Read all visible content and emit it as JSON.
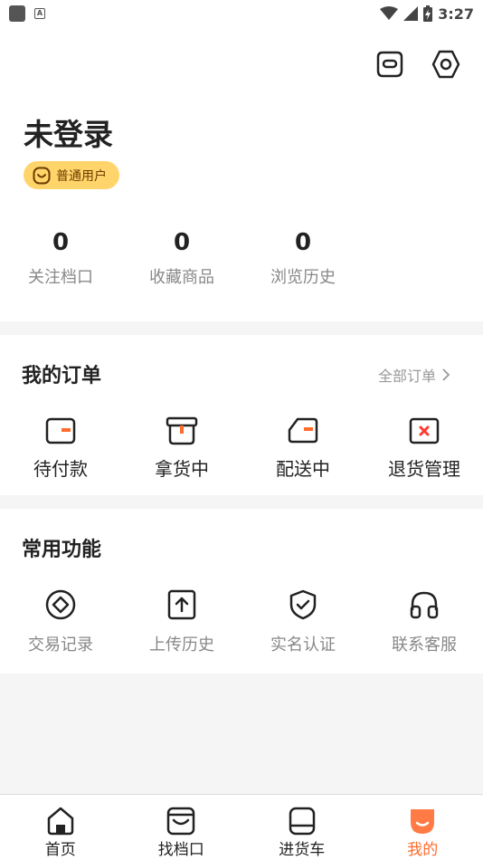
{
  "status_bar": {
    "time": "3:27",
    "battery": "⚡"
  },
  "profile": {
    "name": "未登录",
    "badge": "普通用户"
  },
  "stats": [
    {
      "value": "0",
      "label": "关注档口"
    },
    {
      "value": "0",
      "label": "收藏商品"
    },
    {
      "value": "0",
      "label": "浏览历史"
    }
  ],
  "orders": {
    "title": "我的订单",
    "all_label": "全部订单",
    "items": [
      {
        "label": "待付款",
        "icon": "wallet-icon"
      },
      {
        "label": "拿货中",
        "icon": "box-icon"
      },
      {
        "label": "配送中",
        "icon": "truck-icon"
      },
      {
        "label": "退货管理",
        "icon": "return-icon"
      }
    ]
  },
  "functions": {
    "title": "常用功能",
    "items": [
      {
        "label": "交易记录",
        "icon": "diamond-record-icon"
      },
      {
        "label": "上传历史",
        "icon": "upload-icon"
      },
      {
        "label": "实名认证",
        "icon": "shield-check-icon"
      },
      {
        "label": "联系客服",
        "icon": "headset-icon"
      }
    ]
  },
  "tabbar": [
    {
      "label": "首页",
      "icon": "home-icon",
      "active": false
    },
    {
      "label": "找档口",
      "icon": "store-icon",
      "active": false
    },
    {
      "label": "进货车",
      "icon": "cart-icon",
      "active": false
    },
    {
      "label": "我的",
      "icon": "profile-icon",
      "active": true
    }
  ],
  "colors": {
    "accent": "#ff6b2c",
    "badge_bg": "#ffd46a",
    "muted": "#888888"
  }
}
